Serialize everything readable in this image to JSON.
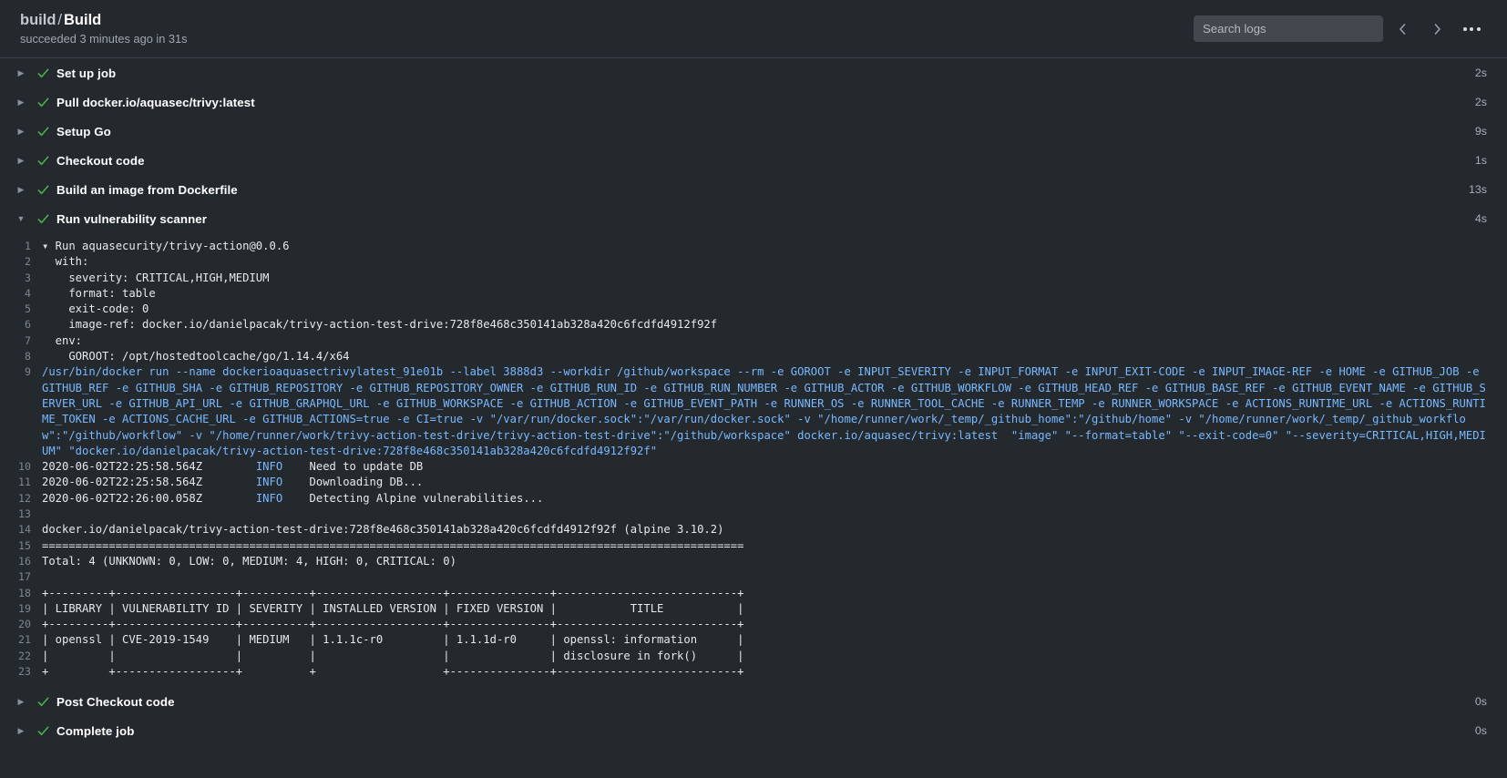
{
  "header": {
    "job_prefix": "build",
    "separator": "/",
    "job_name": "Build",
    "status_line": "succeeded 3 minutes ago in 31s",
    "search_placeholder": "Search logs",
    "search_value": "",
    "prev_label": "Previous",
    "next_label": "Next",
    "menu_label": "Show options"
  },
  "steps_top": [
    {
      "name": "Set up job",
      "duration": "2s",
      "status": "success",
      "expanded": false
    },
    {
      "name": "Pull docker.io/aquasec/trivy:latest",
      "duration": "2s",
      "status": "success",
      "expanded": false
    },
    {
      "name": "Setup Go",
      "duration": "9s",
      "status": "success",
      "expanded": false
    },
    {
      "name": "Checkout code",
      "duration": "1s",
      "status": "success",
      "expanded": false
    },
    {
      "name": "Build an image from Dockerfile",
      "duration": "13s",
      "status": "success",
      "expanded": false
    },
    {
      "name": "Run vulnerability scanner",
      "duration": "4s",
      "status": "success",
      "expanded": true
    }
  ],
  "steps_bottom": [
    {
      "name": "Post Checkout code",
      "duration": "0s",
      "status": "success",
      "expanded": false
    },
    {
      "name": "Complete job",
      "duration": "0s",
      "status": "success",
      "expanded": false
    }
  ],
  "log": {
    "lines": [
      {
        "n": "1",
        "text": "▾ Run aquasecurity/trivy-action@0.0.6",
        "color": "default",
        "wrap": false
      },
      {
        "n": "2",
        "text": "  with:",
        "color": "default",
        "wrap": false
      },
      {
        "n": "3",
        "text": "    severity: CRITICAL,HIGH,MEDIUM",
        "color": "default",
        "wrap": false
      },
      {
        "n": "4",
        "text": "    format: table",
        "color": "default",
        "wrap": false
      },
      {
        "n": "5",
        "text": "    exit-code: 0",
        "color": "default",
        "wrap": false
      },
      {
        "n": "6",
        "text": "    image-ref: docker.io/danielpacak/trivy-action-test-drive:728f8e468c350141ab328a420c6fcdfd4912f92f",
        "color": "default",
        "wrap": false
      },
      {
        "n": "7",
        "text": "  env:",
        "color": "default",
        "wrap": false
      },
      {
        "n": "8",
        "text": "    GOROOT: /opt/hostedtoolcache/go/1.14.4/x64",
        "color": "default",
        "wrap": false
      },
      {
        "n": "9",
        "text": "/usr/bin/docker run --name dockerioaquasectrivylatest_91e01b --label 3888d3 --workdir /github/workspace --rm -e GOROOT -e INPUT_SEVERITY -e INPUT_FORMAT -e INPUT_EXIT-CODE -e INPUT_IMAGE-REF -e HOME -e GITHUB_JOB -e GITHUB_REF -e GITHUB_SHA -e GITHUB_REPOSITORY -e GITHUB_REPOSITORY_OWNER -e GITHUB_RUN_ID -e GITHUB_RUN_NUMBER -e GITHUB_ACTOR -e GITHUB_WORKFLOW -e GITHUB_HEAD_REF -e GITHUB_BASE_REF -e GITHUB_EVENT_NAME -e GITHUB_SERVER_URL -e GITHUB_API_URL -e GITHUB_GRAPHQL_URL -e GITHUB_WORKSPACE -e GITHUB_ACTION -e GITHUB_EVENT_PATH -e RUNNER_OS -e RUNNER_TOOL_CACHE -e RUNNER_TEMP -e RUNNER_WORKSPACE -e ACTIONS_RUNTIME_URL -e ACTIONS_RUNTIME_TOKEN -e ACTIONS_CACHE_URL -e GITHUB_ACTIONS=true -e CI=true -v \"/var/run/docker.sock\":\"/var/run/docker.sock\" -v \"/home/runner/work/_temp/_github_home\":\"/github/home\" -v \"/home/runner/work/_temp/_github_workflow\":\"/github/workflow\" -v \"/home/runner/work/trivy-action-test-drive/trivy-action-test-drive\":\"/github/workspace\" docker.io/aquasec/trivy:latest  \"image\" \"--format=table\" \"--exit-code=0\" \"--severity=CRITICAL,HIGH,MEDIUM\" \"docker.io/danielpacak/trivy-action-test-drive:728f8e468c350141ab328a420c6fcdfd4912f92f\"",
        "color": "blue",
        "wrap": true
      },
      {
        "n": "10",
        "text": "2020-06-02T22:25:58.564Z        INFO    Need to update DB",
        "color": "info",
        "wrap": false,
        "timestamp": "2020-06-02T22:25:58.564Z",
        "level": "INFO",
        "message": "Need to update DB"
      },
      {
        "n": "11",
        "text": "2020-06-02T22:25:58.564Z        INFO    Downloading DB...",
        "color": "info",
        "wrap": false,
        "timestamp": "2020-06-02T22:25:58.564Z",
        "level": "INFO",
        "message": "Downloading DB..."
      },
      {
        "n": "12",
        "text": "2020-06-02T22:26:00.058Z        INFO    Detecting Alpine vulnerabilities...",
        "color": "info",
        "wrap": false,
        "timestamp": "2020-06-02T22:26:00.058Z",
        "level": "INFO",
        "message": "Detecting Alpine vulnerabilities..."
      },
      {
        "n": "13",
        "text": "",
        "color": "default",
        "wrap": false
      },
      {
        "n": "14",
        "text": "docker.io/danielpacak/trivy-action-test-drive:728f8e468c350141ab328a420c6fcdfd4912f92f (alpine 3.10.2)",
        "color": "default",
        "wrap": false
      },
      {
        "n": "15",
        "text": "=========================================================================================================",
        "color": "default",
        "wrap": false
      },
      {
        "n": "16",
        "text": "Total: 4 (UNKNOWN: 0, LOW: 0, MEDIUM: 4, HIGH: 0, CRITICAL: 0)",
        "color": "default",
        "wrap": false
      },
      {
        "n": "17",
        "text": "",
        "color": "default",
        "wrap": false
      },
      {
        "n": "18",
        "text": "+---------+------------------+----------+-------------------+---------------+---------------------------+",
        "color": "default",
        "wrap": false
      },
      {
        "n": "19",
        "text": "| LIBRARY | VULNERABILITY ID | SEVERITY | INSTALLED VERSION | FIXED VERSION |           TITLE           |",
        "color": "default",
        "wrap": false
      },
      {
        "n": "20",
        "text": "+---------+------------------+----------+-------------------+---------------+---------------------------+",
        "color": "default",
        "wrap": false
      },
      {
        "n": "21",
        "text": "| openssl | CVE-2019-1549    | MEDIUM   | 1.1.1c-r0         | 1.1.1d-r0     | openssl: information      |",
        "color": "default",
        "wrap": false
      },
      {
        "n": "22",
        "text": "|         |                  |          |                   |               | disclosure in fork()      |",
        "color": "default",
        "wrap": false
      },
      {
        "n": "23",
        "text": "+         +------------------+          +                   +---------------+---------------------------+",
        "color": "default",
        "wrap": false
      }
    ],
    "scan_summary": {
      "image": "docker.io/danielpacak/trivy-action-test-drive:728f8e468c350141ab328a420c6fcdfd4912f92f",
      "os": "alpine 3.10.2",
      "total": 4,
      "unknown": 0,
      "low": 0,
      "medium": 4,
      "high": 0,
      "critical": 0,
      "columns": [
        "LIBRARY",
        "VULNERABILITY ID",
        "SEVERITY",
        "INSTALLED VERSION",
        "FIXED VERSION",
        "TITLE"
      ],
      "rows": [
        {
          "library": "openssl",
          "vulnerability_id": "CVE-2019-1549",
          "severity": "MEDIUM",
          "installed_version": "1.1.1c-r0",
          "fixed_version": "1.1.1d-r0",
          "title": "openssl: information disclosure in fork()"
        }
      ]
    }
  },
  "colors": {
    "background": "#24292e",
    "success": "#4caf50",
    "link_blue": "#79b8ff",
    "text": "#e1e4e8",
    "muted": "#a0a6ad"
  }
}
